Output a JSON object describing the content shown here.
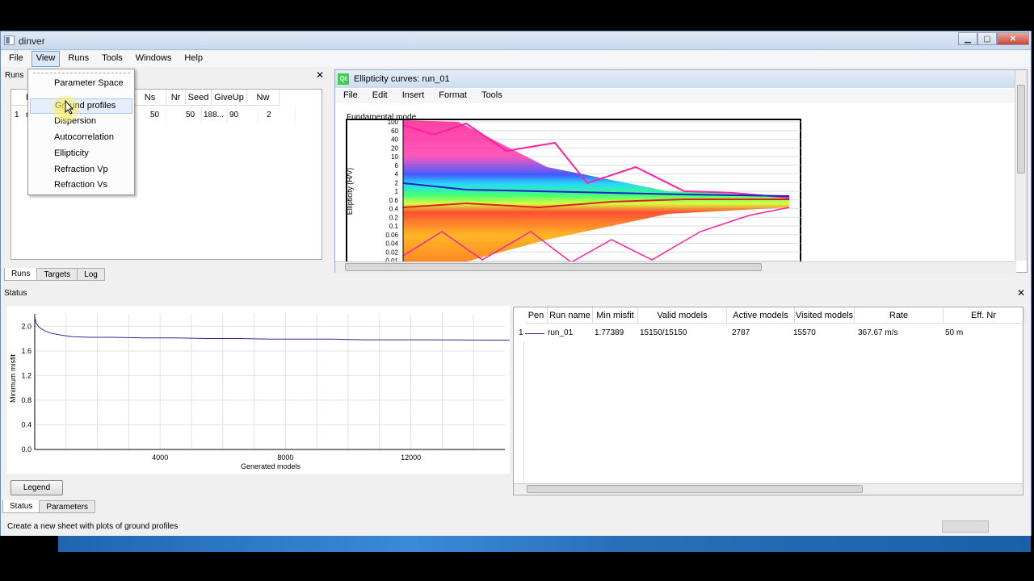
{
  "window": {
    "title": "dinver"
  },
  "menubar": [
    "File",
    "View",
    "Runs",
    "Tools",
    "Windows",
    "Help"
  ],
  "view_menu": {
    "items": [
      "Parameter Space",
      "Ground profiles",
      "Dispersion",
      "Autocorrelation",
      "Ellipticity",
      "Refraction Vp",
      "Refraction Vs"
    ],
    "hovered": "Ground profiles"
  },
  "runs_dock": {
    "title": "Runs",
    "columns": [
      "R",
      "Ns",
      "Nr",
      "Seed",
      "GiveUp",
      "Nw"
    ],
    "rows": [
      {
        "index": "1",
        "name": "r",
        "ns": "50",
        "nr": "50",
        "seed": "188...",
        "giveup": "90",
        "nw": "2"
      }
    ],
    "tabs": [
      "Runs",
      "Targets",
      "Log"
    ]
  },
  "ellipticity_window": {
    "title": "Ellipticity curves: run_01",
    "menu": [
      "File",
      "Edit",
      "Insert",
      "Format",
      "Tools"
    ],
    "plot_title": "Fundamental mode",
    "ylabel": "Ellipticity (H/V)",
    "yticks": [
      "100",
      "60",
      "40",
      "20",
      "10",
      "6",
      "4",
      "2",
      "1",
      "0.6",
      "0.4",
      "0.2",
      "0.1",
      "0.06",
      "0.04",
      "0.02",
      "0.01"
    ]
  },
  "status": {
    "title": "Status",
    "table_columns": [
      "Pen",
      "Run name",
      "Min misfit",
      "Valid models",
      "Active models",
      "Visited models",
      "Rate",
      "Eff. Nr"
    ],
    "table_rows": [
      {
        "index": "1",
        "run": "run_01",
        "min_misfit": "1.77389",
        "valid": "15150/15150",
        "active": "2787",
        "visited": "15570",
        "rate": "367.67 m/s",
        "effnr": "50 m"
      }
    ],
    "legend_label": "Legend",
    "tabs": [
      "Status",
      "Parameters"
    ],
    "status_message": "Create a new sheet with plots of ground profiles"
  },
  "chart_data": {
    "type": "line",
    "title": "",
    "xlabel": "Generated models",
    "ylabel": "Minimum misfit",
    "xlim": [
      0,
      15000
    ],
    "ylim": [
      0,
      2.2
    ],
    "xticks": [
      4000,
      8000,
      12000
    ],
    "yticks": [
      0.0,
      0.4,
      0.8,
      1.2,
      1.6,
      2.0
    ],
    "ytick_labels": [
      "0.0",
      "0.4",
      "0.8",
      "1.2",
      "1.6",
      "2.0"
    ],
    "series": [
      {
        "x": [
          0,
          50,
          150,
          300,
          500,
          800,
          1200,
          1800,
          2500,
          3500,
          4500,
          5500,
          6500,
          7500,
          8500,
          9500,
          10500,
          11500,
          12500,
          13500,
          14500,
          15150
        ],
        "y": [
          2.15,
          2.04,
          1.98,
          1.93,
          1.89,
          1.86,
          1.83,
          1.82,
          1.82,
          1.81,
          1.81,
          1.8,
          1.8,
          1.79,
          1.79,
          1.79,
          1.78,
          1.78,
          1.78,
          1.777,
          1.774,
          1.774
        ]
      }
    ],
    "color": "#2a2aa0"
  }
}
